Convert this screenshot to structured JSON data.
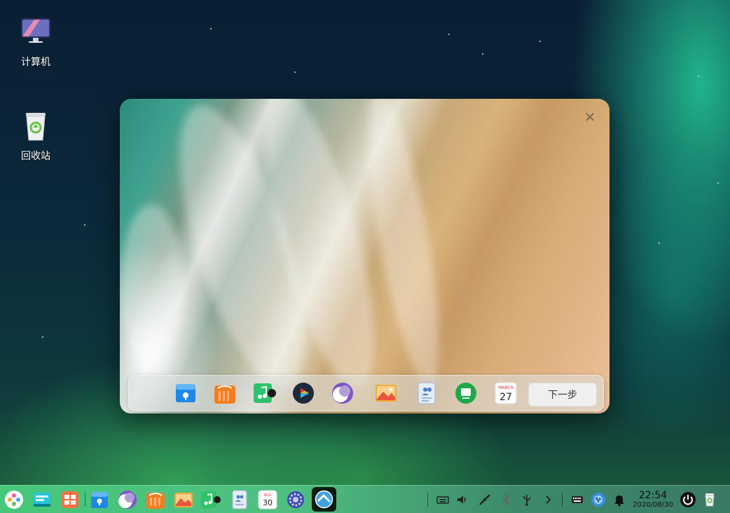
{
  "desktop": {
    "icons": [
      {
        "label": "计算机",
        "icon": "computer-icon"
      },
      {
        "label": "回收站",
        "icon": "trash-icon"
      }
    ]
  },
  "welcome": {
    "next_label": "下一步",
    "close_glyph": "✕",
    "dock_apps": [
      "app-store-icon",
      "shop-icon",
      "music-icon",
      "video-player-icon",
      "browser-icon",
      "image-viewer-icon",
      "contacts-icon",
      "chat-icon",
      "calendar-icon"
    ],
    "calendar_month": "MARCH",
    "calendar_day": "27"
  },
  "taskbar": {
    "calendar_month": "AUG",
    "calendar_day": "30",
    "time": "22:54",
    "date": "2020/08/30"
  }
}
